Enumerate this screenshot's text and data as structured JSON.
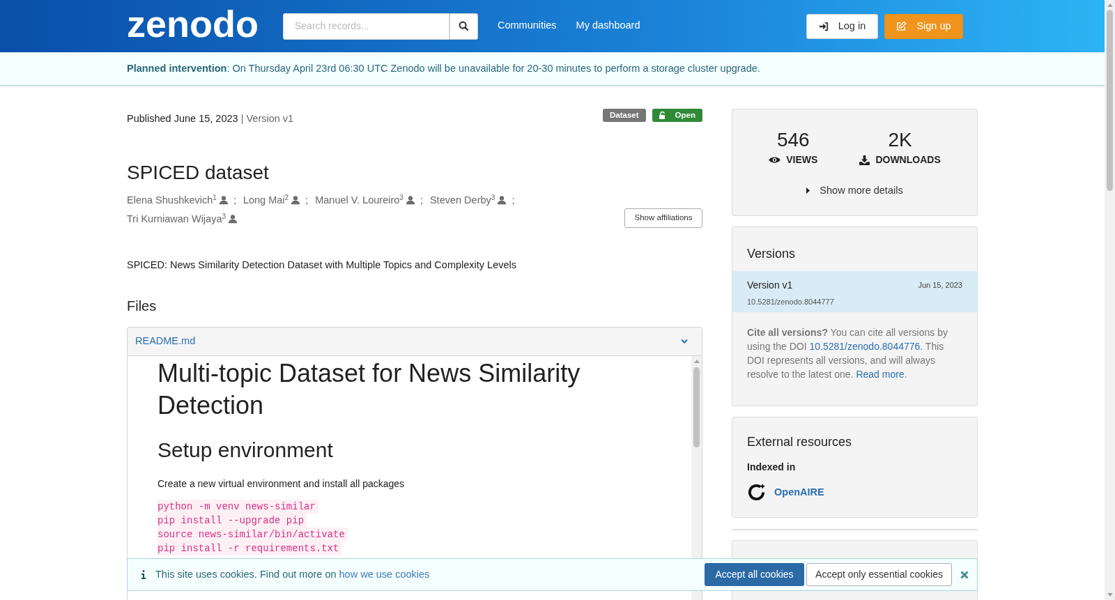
{
  "header": {
    "logo": "zenodo",
    "search": {
      "placeholder": "Search records..."
    },
    "nav": [
      "Communities",
      "My dashboard"
    ],
    "login": "Log in",
    "signup": "Sign up"
  },
  "notice": {
    "title": "Planned intervention",
    "text": ": On Thursday April 23rd 06:30 UTC Zenodo will be unavailable for 20-30 minutes to perform a storage cluster upgrade."
  },
  "record": {
    "published": "Published June 15, 2023",
    "version": "| Version v1",
    "badges": [
      {
        "label": "Dataset",
        "kind": "type"
      },
      {
        "label": "Open",
        "kind": "access"
      }
    ],
    "title": "SPICED dataset",
    "authors": [
      {
        "name": "Elena Shushkevich",
        "aff": "1"
      },
      {
        "name": "Long Mai",
        "aff": "2"
      },
      {
        "name": "Manuel V. Loureiro",
        "aff": "3"
      },
      {
        "name": "Steven Derby",
        "aff": "3"
      },
      {
        "name": "Tri Kurniawan Wijaya",
        "aff": "3"
      }
    ],
    "separator": ";",
    "show_affiliations": "Show affiliations",
    "description": "SPICED: News Similarity Detection Dataset with Multiple Topics and Complexity Levels"
  },
  "files": {
    "heading": "Files",
    "file": "README.md",
    "expanded": true,
    "preview": {
      "h1": "Multi-topic Dataset for News Similarity Detection",
      "h2": "Setup environment",
      "p": "Create a new virtual environment and install all packages",
      "code": [
        "python -m venv news-similar",
        "pip install --upgrade pip",
        "source news-similar/bin/activate",
        "pip install -r requirements.txt"
      ]
    }
  },
  "stats": {
    "items": [
      {
        "value": "546",
        "label": "VIEWS",
        "kind": "views"
      },
      {
        "value": "2K",
        "label": "DOWNLOADS",
        "kind": "downloads"
      }
    ],
    "more": "Show more details"
  },
  "versions": {
    "title": "Versions",
    "items": [
      {
        "name": "Version v1",
        "date": "Jun 15, 2023",
        "doi": "10.5281/zenodo.8044777",
        "selected": true
      }
    ],
    "cite_bold": "Cite all versions?",
    "cite_text1": " You can cite all versions by using the DOI ",
    "cite_link": "10.5281/zenodo.8044776",
    "cite_text2": ". This DOI represents all versions, and will always resolve to the latest one. ",
    "read_more": "Read more",
    "cite_end": "."
  },
  "external": {
    "title": "External resources",
    "subtitle": "Indexed in",
    "items": [
      "OpenAIRE"
    ]
  },
  "cookies": {
    "text": "This site uses cookies. Find out more on ",
    "link": "how we use cookies",
    "accept_all": "Accept all cookies",
    "accept_essential": "Accept only essential cookies"
  }
}
